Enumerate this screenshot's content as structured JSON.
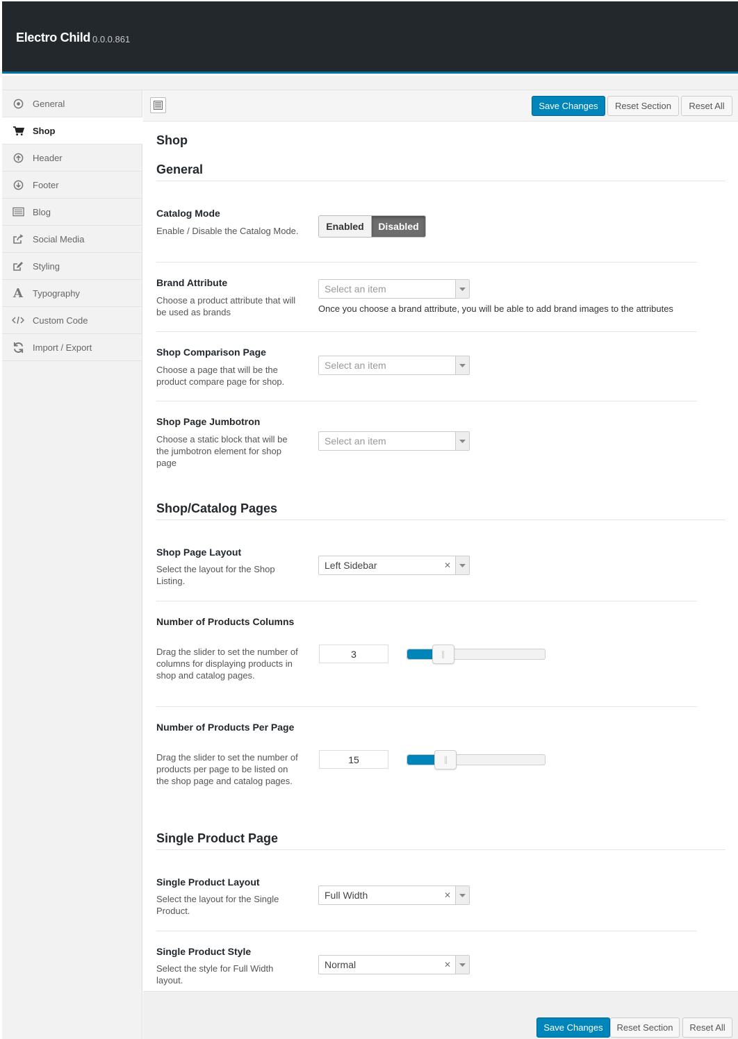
{
  "app": {
    "title": "Electro Child",
    "version": "0.0.0.861"
  },
  "sidebar": {
    "items": [
      {
        "label": "General",
        "icon": "circle-dot-icon",
        "active": false
      },
      {
        "label": "Shop",
        "icon": "cart-icon",
        "active": true
      },
      {
        "label": "Header",
        "icon": "arrow-up-circle-icon",
        "active": false
      },
      {
        "label": "Footer",
        "icon": "arrow-down-circle-icon",
        "active": false
      },
      {
        "label": "Blog",
        "icon": "list-icon",
        "active": false
      },
      {
        "label": "Social Media",
        "icon": "share-icon",
        "active": false
      },
      {
        "label": "Styling",
        "icon": "edit-icon",
        "active": false
      },
      {
        "label": "Typography",
        "icon": "font-icon",
        "active": false
      },
      {
        "label": "Custom Code",
        "icon": "code-icon",
        "active": false
      },
      {
        "label": "Import / Export",
        "icon": "refresh-icon",
        "active": false
      }
    ]
  },
  "toolbar": {
    "save_label": "Save Changes",
    "reset_section_label": "Reset Section",
    "reset_all_label": "Reset All"
  },
  "page": {
    "title": "Shop"
  },
  "sections": {
    "general": {
      "title": "General",
      "catalog_mode": {
        "title": "Catalog Mode",
        "desc": "Enable / Disable the Catalog Mode.",
        "enabled_label": "Enabled",
        "disabled_label": "Disabled",
        "selected": "Disabled"
      },
      "brand_attribute": {
        "title": "Brand Attribute",
        "desc": "Choose a product attribute that will be used as brands",
        "placeholder": "Select an item",
        "helper": "Once you choose a brand attribute, you will be able to add brand images to the attributes"
      },
      "shop_comparison": {
        "title": "Shop Comparison Page",
        "desc": "Choose a page that will be the product compare page for shop.",
        "placeholder": "Select an item"
      },
      "shop_jumbotron": {
        "title": "Shop Page Jumbotron",
        "desc": "Choose a static block that will be the jumbotron element for shop page",
        "placeholder": "Select an item"
      }
    },
    "catalog": {
      "title": "Shop/Catalog Pages",
      "layout": {
        "title": "Shop Page Layout",
        "desc": "Select the layout for the Shop Listing.",
        "value": "Left Sidebar"
      },
      "columns": {
        "title": "Number of Products Columns",
        "desc": "Drag the slider to set the number of columns for displaying products in shop and catalog pages.",
        "value": "3",
        "slider_fraction": 0.25
      },
      "per_page": {
        "title": "Number of Products Per Page",
        "desc": "Drag the slider to set the number of products per page to be listed on the shop page and catalog pages.",
        "value": "15",
        "slider_fraction": 0.27
      }
    },
    "single": {
      "title": "Single Product Page",
      "layout": {
        "title": "Single Product Layout",
        "desc": "Select the layout for the Single Product.",
        "value": "Full Width"
      },
      "style": {
        "title": "Single Product Style",
        "desc": "Select the style for Full Width layout.",
        "value": "Normal"
      }
    }
  },
  "colors": {
    "accent": "#0085ba",
    "topbar": "#23282d",
    "topbar_border": "#0074a2"
  }
}
